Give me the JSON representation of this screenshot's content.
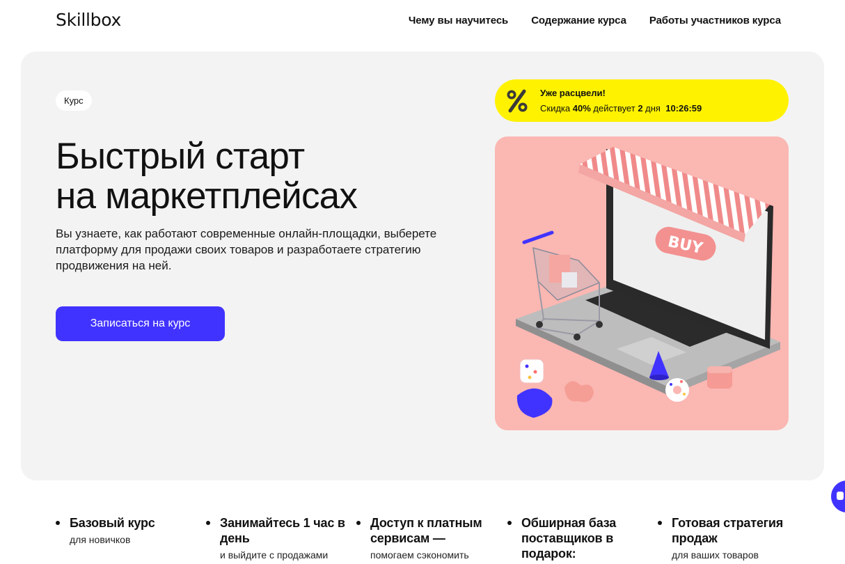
{
  "header": {
    "logo": "Skillbox",
    "nav": [
      {
        "label": "Чему вы научитесь"
      },
      {
        "label": "Содержание курса"
      },
      {
        "label": "Работы участников курса"
      }
    ]
  },
  "hero": {
    "badge": "Курс",
    "title_line1": "Быстрый старт",
    "title_line2": "на маркетплейсах",
    "description": "Вы узнаете, как работают современные онлайн-площадки, выберете платформу для продажи своих товаров и разработаете стратегию продвижения на ней.",
    "cta_label": "Записаться на курс",
    "promo": {
      "title": "Уже расцвели!",
      "prefix": "Скидка",
      "discount": "40%",
      "middle": "действует",
      "days": "2",
      "days_label": "дня",
      "timer": "10:26:59"
    },
    "illustration": {
      "buy_label": "BUY"
    }
  },
  "features": [
    {
      "title": "Базовый курс",
      "subtitle": "для новичков"
    },
    {
      "title": "Занимайтесь 1 час в день",
      "subtitle": "и выйдите с продажами"
    },
    {
      "title": "Доступ к платным сервисам —",
      "subtitle": "помогаем сэкономить"
    },
    {
      "title": "Обширная база поставщиков в подарок:",
      "subtitle": ""
    },
    {
      "title": "Готовая стратегия продаж",
      "subtitle": "для ваших товаров"
    }
  ],
  "colors": {
    "accent": "#4133ff",
    "promo": "#fff200",
    "illustration_bg": "#fbb7b2",
    "hero_bg": "#f3f3f3"
  }
}
